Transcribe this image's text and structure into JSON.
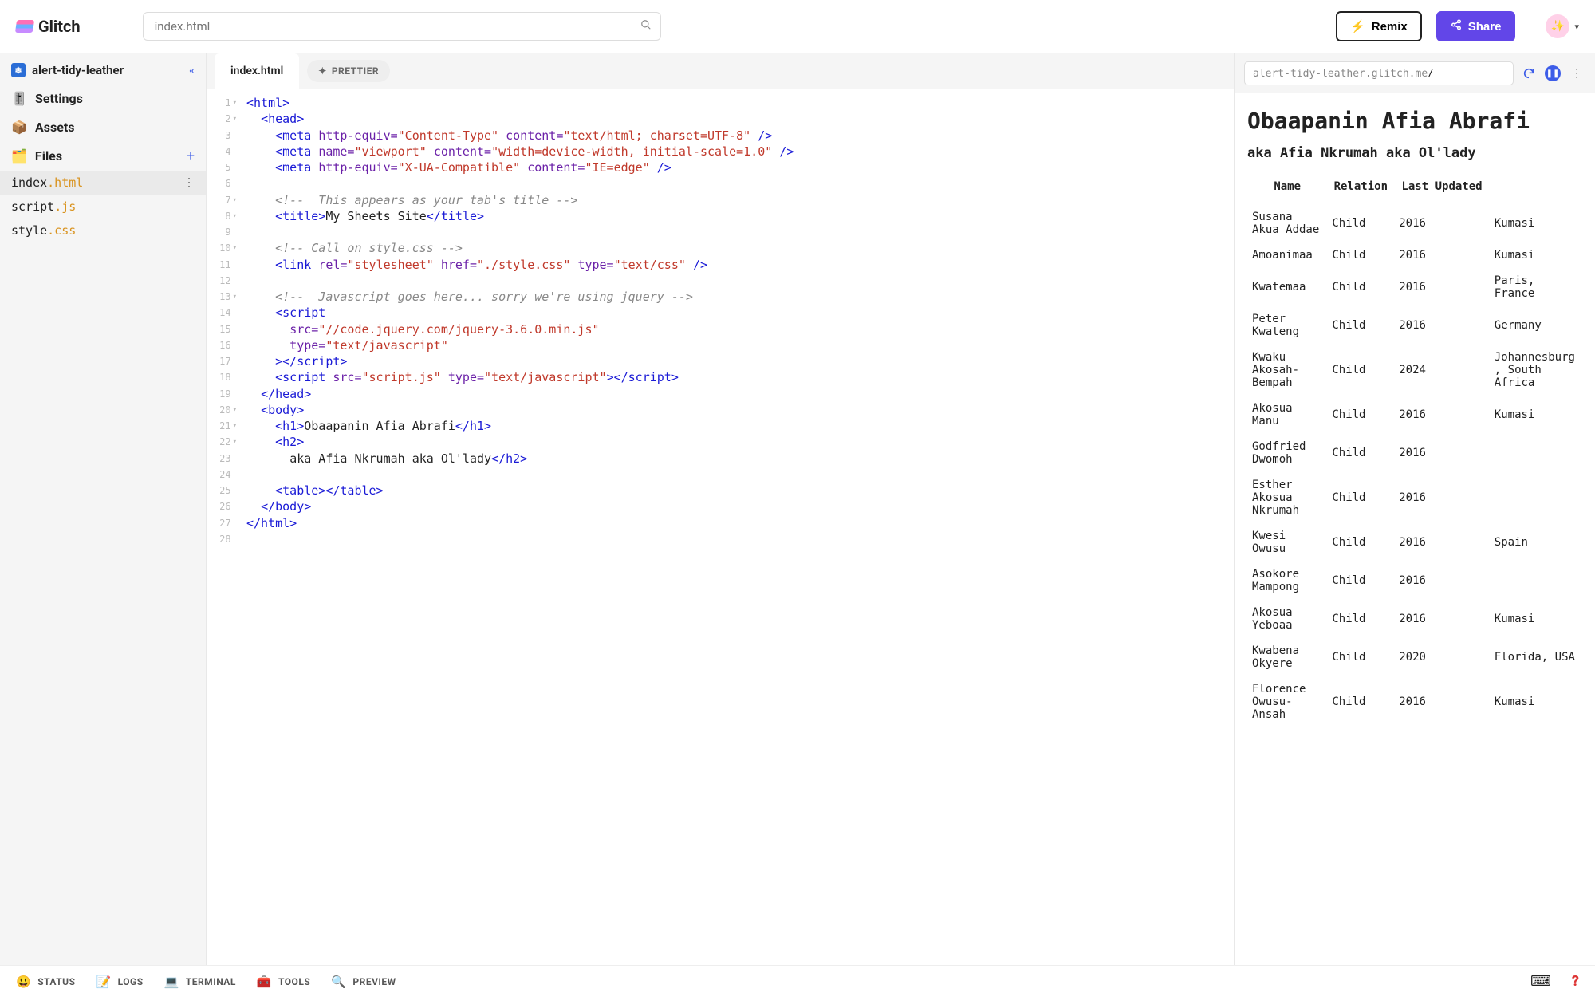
{
  "brand": "Glitch",
  "search": {
    "placeholder": "index.html"
  },
  "actions": {
    "remix": "Remix",
    "share": "Share"
  },
  "avatar_emoji": "✨",
  "project": {
    "name": "alert-tidy-leather",
    "nav": {
      "settings": "Settings",
      "assets": "Assets",
      "files": "Files"
    },
    "files": [
      {
        "base": "index",
        "ext": ".html",
        "active": true
      },
      {
        "base": "script",
        "ext": ".js",
        "active": false
      },
      {
        "base": "style",
        "ext": ".css",
        "active": false
      }
    ]
  },
  "editor": {
    "tab": "index.html",
    "prettier": "PRETTIER",
    "lines": [
      {
        "n": 1,
        "fold": true,
        "ind": 0,
        "tok": [
          [
            "tag",
            "<html>"
          ]
        ]
      },
      {
        "n": 2,
        "fold": true,
        "ind": 1,
        "tok": [
          [
            "tag",
            "<head>"
          ]
        ]
      },
      {
        "n": 3,
        "fold": false,
        "ind": 2,
        "tok": [
          [
            "tag",
            "<meta"
          ],
          [
            "txt",
            " "
          ],
          [
            "attr",
            "http-equiv="
          ],
          [
            "str",
            "\"Content-Type\""
          ],
          [
            "txt",
            " "
          ],
          [
            "attr",
            "content="
          ],
          [
            "str",
            "\"text/html; charset=UTF-8\""
          ],
          [
            "txt",
            " "
          ],
          [
            "tag",
            "/>"
          ]
        ]
      },
      {
        "n": 4,
        "fold": false,
        "ind": 2,
        "tok": [
          [
            "tag",
            "<meta"
          ],
          [
            "txt",
            " "
          ],
          [
            "attr",
            "name="
          ],
          [
            "str",
            "\"viewport\""
          ],
          [
            "txt",
            " "
          ],
          [
            "attr",
            "content="
          ],
          [
            "str",
            "\"width=device-width, initial-scale=1.0\""
          ],
          [
            "txt",
            " "
          ],
          [
            "tag",
            "/>"
          ]
        ]
      },
      {
        "n": 5,
        "fold": false,
        "ind": 2,
        "tok": [
          [
            "tag",
            "<meta"
          ],
          [
            "txt",
            " "
          ],
          [
            "attr",
            "http-equiv="
          ],
          [
            "str",
            "\"X-UA-Compatible\""
          ],
          [
            "txt",
            " "
          ],
          [
            "attr",
            "content="
          ],
          [
            "str",
            "\"IE=edge\""
          ],
          [
            "txt",
            " "
          ],
          [
            "tag",
            "/>"
          ]
        ]
      },
      {
        "n": 6,
        "fold": false,
        "ind": 0,
        "tok": []
      },
      {
        "n": 7,
        "fold": true,
        "ind": 2,
        "tok": [
          [
            "cmt",
            "<!--  This appears as your tab's title -->"
          ]
        ]
      },
      {
        "n": 8,
        "fold": true,
        "ind": 2,
        "tok": [
          [
            "tag",
            "<title>"
          ],
          [
            "txt",
            "My Sheets Site"
          ],
          [
            "tag",
            "</title>"
          ]
        ]
      },
      {
        "n": 9,
        "fold": false,
        "ind": 0,
        "tok": []
      },
      {
        "n": 10,
        "fold": true,
        "ind": 2,
        "tok": [
          [
            "cmt",
            "<!-- Call on style.css -->"
          ]
        ]
      },
      {
        "n": 11,
        "fold": false,
        "ind": 2,
        "tok": [
          [
            "tag",
            "<link"
          ],
          [
            "txt",
            " "
          ],
          [
            "attr",
            "rel="
          ],
          [
            "str",
            "\"stylesheet\""
          ],
          [
            "txt",
            " "
          ],
          [
            "attr",
            "href="
          ],
          [
            "str",
            "\"./style.css\""
          ],
          [
            "txt",
            " "
          ],
          [
            "attr",
            "type="
          ],
          [
            "str",
            "\"text/css\""
          ],
          [
            "txt",
            " "
          ],
          [
            "tag",
            "/>"
          ]
        ]
      },
      {
        "n": 12,
        "fold": false,
        "ind": 0,
        "tok": []
      },
      {
        "n": 13,
        "fold": true,
        "ind": 2,
        "tok": [
          [
            "cmt",
            "<!--  Javascript goes here... sorry we're using jquery -->"
          ]
        ]
      },
      {
        "n": 14,
        "fold": false,
        "ind": 2,
        "tok": [
          [
            "tag",
            "<script"
          ]
        ]
      },
      {
        "n": 15,
        "fold": false,
        "ind": 3,
        "tok": [
          [
            "attr",
            "src="
          ],
          [
            "str",
            "\"//code.jquery.com/jquery-3.6.0.min.js\""
          ]
        ]
      },
      {
        "n": 16,
        "fold": false,
        "ind": 3,
        "tok": [
          [
            "attr",
            "type="
          ],
          [
            "str",
            "\"text/javascript\""
          ]
        ]
      },
      {
        "n": 17,
        "fold": false,
        "ind": 2,
        "tok": [
          [
            "tag",
            "></script"
          ],
          [
            "tag",
            ">"
          ]
        ]
      },
      {
        "n": 18,
        "fold": false,
        "ind": 2,
        "tok": [
          [
            "tag",
            "<script"
          ],
          [
            "txt",
            " "
          ],
          [
            "attr",
            "src="
          ],
          [
            "str",
            "\"script.js\""
          ],
          [
            "txt",
            " "
          ],
          [
            "attr",
            "type="
          ],
          [
            "str",
            "\"text/javascript\""
          ],
          [
            "tag",
            "></script"
          ],
          [
            "tag",
            ">"
          ]
        ]
      },
      {
        "n": 19,
        "fold": false,
        "ind": 1,
        "tok": [
          [
            "tag",
            "</head>"
          ]
        ]
      },
      {
        "n": 20,
        "fold": true,
        "ind": 1,
        "tok": [
          [
            "tag",
            "<body>"
          ]
        ]
      },
      {
        "n": 21,
        "fold": true,
        "ind": 2,
        "tok": [
          [
            "tag",
            "<h1>"
          ],
          [
            "txt",
            "Obaapanin Afia Abrafi"
          ],
          [
            "tag",
            "</h1>"
          ]
        ]
      },
      {
        "n": 22,
        "fold": true,
        "ind": 2,
        "tok": [
          [
            "tag",
            "<h2>"
          ]
        ]
      },
      {
        "n": 23,
        "fold": false,
        "ind": 3,
        "tok": [
          [
            "txt",
            "aka Afia Nkrumah aka Ol'lady"
          ],
          [
            "tag",
            "</h2>"
          ]
        ]
      },
      {
        "n": 24,
        "fold": false,
        "ind": 0,
        "tok": []
      },
      {
        "n": 25,
        "fold": false,
        "ind": 2,
        "tok": [
          [
            "tag",
            "<table>"
          ],
          [
            "tag",
            "</table>"
          ]
        ]
      },
      {
        "n": 26,
        "fold": false,
        "ind": 1,
        "tok": [
          [
            "tag",
            "</body>"
          ]
        ]
      },
      {
        "n": 27,
        "fold": false,
        "ind": 0,
        "tok": [
          [
            "tag",
            "</html>"
          ]
        ]
      },
      {
        "n": 28,
        "fold": false,
        "ind": 0,
        "tok": []
      }
    ]
  },
  "preview": {
    "url_host": "alert-tidy-leather.glitch.me",
    "url_path": "/",
    "h1": "Obaapanin Afia Abrafi",
    "h2": "aka Afia Nkrumah aka Ol'lady",
    "columns": [
      "Name",
      "Relation",
      "Last Updated",
      ""
    ],
    "rows": [
      {
        "name": "Susana Akua Addae",
        "relation": "Child",
        "updated": "2016",
        "loc": "Kumasi"
      },
      {
        "name": "Amoanimaa",
        "relation": "Child",
        "updated": "2016",
        "loc": "Kumasi"
      },
      {
        "name": "Kwatemaa",
        "relation": "Child",
        "updated": "2016",
        "loc": "Paris, France"
      },
      {
        "name": "Peter Kwateng",
        "relation": "Child",
        "updated": "2016",
        "loc": "Germany"
      },
      {
        "name": "Kwaku Akosah-Bempah",
        "relation": "Child",
        "updated": "2024",
        "loc": "Johannesburg, South Africa"
      },
      {
        "name": "Akosua Manu",
        "relation": "Child",
        "updated": "2016",
        "loc": "Kumasi"
      },
      {
        "name": "Godfried Dwomoh",
        "relation": "Child",
        "updated": "2016",
        "loc": ""
      },
      {
        "name": "Esther Akosua Nkrumah",
        "relation": "Child",
        "updated": "2016",
        "loc": ""
      },
      {
        "name": "Kwesi Owusu",
        "relation": "Child",
        "updated": "2016",
        "loc": "Spain"
      },
      {
        "name": "Asokore Mampong",
        "relation": "Child",
        "updated": "2016",
        "loc": ""
      },
      {
        "name": "Akosua Yeboaa",
        "relation": "Child",
        "updated": "2016",
        "loc": "Kumasi"
      },
      {
        "name": "Kwabena Okyere",
        "relation": "Child",
        "updated": "2020",
        "loc": "Florida, USA"
      },
      {
        "name": "Florence Owusu-Ansah",
        "relation": "Child",
        "updated": "2016",
        "loc": "Kumasi"
      }
    ]
  },
  "footer": {
    "status": "STATUS",
    "logs": "LOGS",
    "terminal": "TERMINAL",
    "tools": "TOOLS",
    "preview": "PREVIEW"
  }
}
